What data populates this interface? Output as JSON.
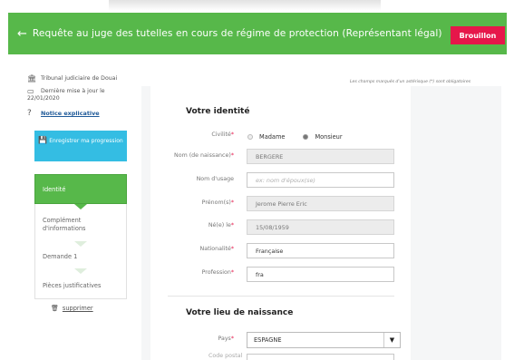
{
  "header": {
    "back_icon": "arrow-left-icon",
    "title": "Requête au juge des tutelles en cours de régime de protection (Représentant légal)",
    "status_badge": "Brouillon",
    "color": "#57b84a",
    "badge_color": "#e6174a"
  },
  "sidebar": {
    "court": "Tribunal judiciaire de Douai",
    "last_update_label": "Dernière mise à jour le",
    "last_update_date": "22/01/2020",
    "notice_link": "Notice explicative",
    "save_button": "Enregistrer ma progression",
    "steps": [
      {
        "label": "Identité",
        "active": true
      },
      {
        "label": "Complément d'informations",
        "active": false
      },
      {
        "label": "Demande 1",
        "active": false
      },
      {
        "label": "Pièces justificatives",
        "active": false
      }
    ],
    "delete_link": "supprimer"
  },
  "form": {
    "required_note": "Les champs marqués d'un astérisque (*) sont obligatoires",
    "identity_title": "Votre identité",
    "civility_label": "Civilité",
    "civility_options": [
      "Madame",
      "Monsieur"
    ],
    "civility_selected": "Monsieur",
    "birth_name_label": "Nom (de naissance)",
    "birth_name_value": "BERGERE",
    "usage_name_label": "Nom d'usage",
    "usage_name_placeholder": "ex: nom d'époux(se)",
    "firstnames_label": "Prénom(s)",
    "firstnames_value": "Jerome Pierre Eric",
    "birthdate_label": "Né(e) le",
    "birthdate_value": "15/08/1959",
    "nationality_label": "Nationalité",
    "nationality_value": "Française",
    "profession_label": "Profession",
    "profession_value": "fra",
    "birthplace_title": "Votre lieu de naissance",
    "country_label": "Pays",
    "country_value": "ESPAGNE",
    "postal_code_label": "Code postal"
  }
}
